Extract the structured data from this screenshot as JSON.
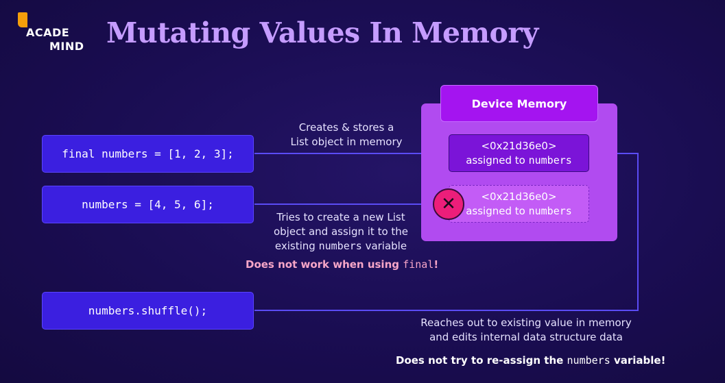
{
  "logo": {
    "line1": "ACADE",
    "line2": "MIND"
  },
  "title": "Mutating Values In Memory",
  "code": {
    "line1": "final numbers = [1, 2, 3];",
    "line2": "numbers = [4, 5, 6];",
    "line3": "numbers.shuffle();"
  },
  "memory": {
    "header": "Device Memory",
    "slot1": {
      "address": "<0x21d36e0>",
      "prefix": "assigned to ",
      "var": "numbers"
    },
    "slot2": {
      "address": "<0x21d36e0>",
      "prefix": "assigned to ",
      "var": "numbers"
    },
    "x_glyph": "✕"
  },
  "notes": {
    "create_1": "Creates & stores a",
    "create_2": "List object in memory",
    "try_1": "Tries to create a new List",
    "try_2": "object and assign it to the",
    "try_3_pre": "existing ",
    "try_3_var": "numbers",
    "try_3_post": " variable",
    "fail_pre": "Does not work when using ",
    "fail_kw": "final",
    "fail_post": "!",
    "reach_1": "Reaches out to existing value in memory",
    "reach_2": "and edits internal data structure data",
    "noreassign_pre": "Does not try to re-assign the ",
    "noreassign_var": "numbers",
    "noreassign_post": " variable!"
  },
  "colors": {
    "background": "#1a0d52",
    "title": "#c59cff",
    "code_box": "#3b1fe0",
    "memory_panel": "#b14bf0",
    "memory_header": "#a414f0",
    "arrow": "#5b4cf5",
    "error": "#ec1e7a",
    "warning_text": "#f7a6c8"
  }
}
